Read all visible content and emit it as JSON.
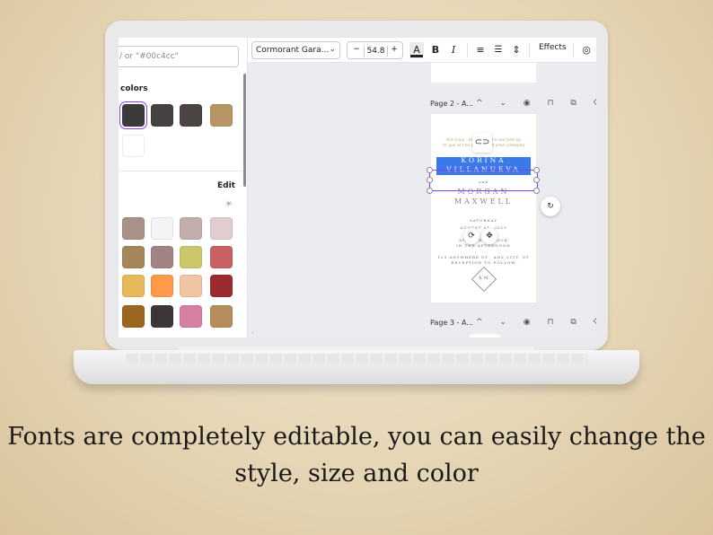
{
  "search": {
    "placeholder": "/ or \"#00c4cc\""
  },
  "colors_section": {
    "title": "colors",
    "swatches": [
      "#3b3b3b",
      "#444140",
      "#4a4442",
      "#b89564",
      "#ffffff"
    ]
  },
  "palette_section": {
    "edit_label": "Edit",
    "sparkle": "✳",
    "swatches": [
      "#a99189",
      "#f4f4f6",
      "#c3aeae",
      "#e1cdcf",
      "#a4865a",
      "#a28384",
      "#ccc66a",
      "#c96163",
      "#e6b95a",
      "#ff9a4a",
      "#efc5a4",
      "#9d2a2f",
      "#9c6621",
      "#3d3636",
      "#d580a3",
      "#b58d5a"
    ]
  },
  "toolbar": {
    "font_name": "Cormorant Gara...",
    "chevron": "⌄",
    "font_size": "54.8",
    "minus": "−",
    "plus": "+",
    "text_color_glyph": "A",
    "bold": "B",
    "italic": "I",
    "align_icon": "≡",
    "list_icon": "☰",
    "spacing_icon": "⇕",
    "effects": "Effects",
    "animate_icon": "◎"
  },
  "pages": {
    "page2_label": "Page 2 - A...",
    "page3_label": "Page 3 - A...",
    "header_icons": "^ ⌄ ◉ ⊓ ⧉ ⌫"
  },
  "invitation": {
    "script_line1": "Wit h joy , together wit h our fam ily",
    "script_line2": "re que st t he pleasure of your company",
    "name_line1": "KORINA",
    "name_line2": "VILLANUEVA",
    "and": "and",
    "groom_line1": "MORGAN",
    "groom_line2": "MAXWELL",
    "day": "SATURDAY",
    "date": "AUGUST 21, 2025",
    "time1": "AT FOUR O'CLOCK",
    "time2": "IN THE AFTERNOON",
    "venue1": "123 ANYWHERE ST., ANY CITY, ST",
    "venue2": "RECEPTION TO FOLLOW",
    "monogram": "K M"
  },
  "caption": {
    "line1": "Fonts are completely editable, you can easily change the",
    "line2": "style, size and color"
  }
}
